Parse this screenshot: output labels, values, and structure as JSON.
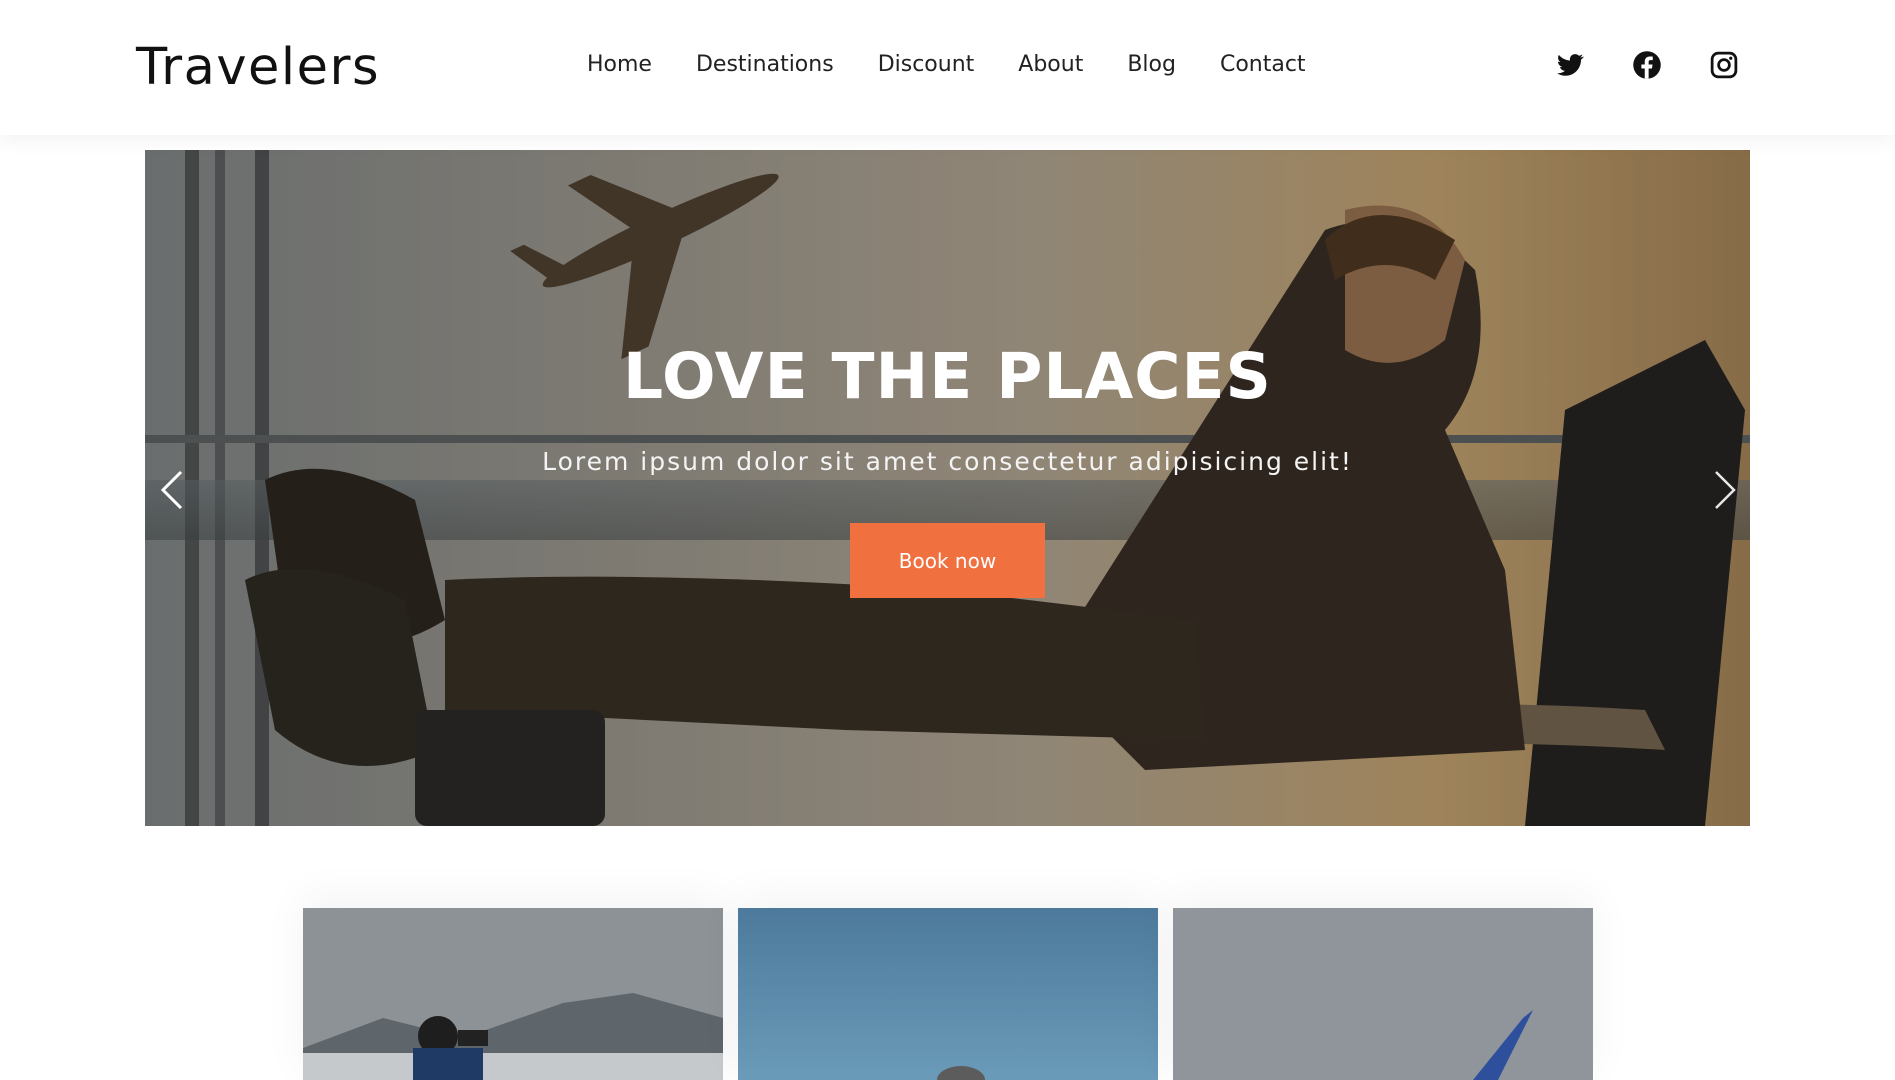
{
  "brand": {
    "name": "Travelers"
  },
  "nav": {
    "items": [
      {
        "label": "Home"
      },
      {
        "label": "Destinations"
      },
      {
        "label": "Discount"
      },
      {
        "label": "About"
      },
      {
        "label": "Blog"
      },
      {
        "label": "Contact"
      }
    ]
  },
  "social": {
    "icons": [
      "twitter-icon",
      "facebook-icon",
      "instagram-icon"
    ]
  },
  "hero": {
    "title": "LOVE THE PLACES",
    "subtitle": "Lorem ipsum dolor sit amet consectetur adipisicing elit!",
    "button_label": "Book now",
    "button_color": "#f07040"
  },
  "carousel": {
    "prev_icon": "chevron-left-icon",
    "next_icon": "chevron-right-icon"
  },
  "cards": [
    {
      "image": "photographer-mountains-image"
    },
    {
      "image": "traveler-blue-sky-image"
    },
    {
      "image": "airplane-wing-image"
    }
  ]
}
